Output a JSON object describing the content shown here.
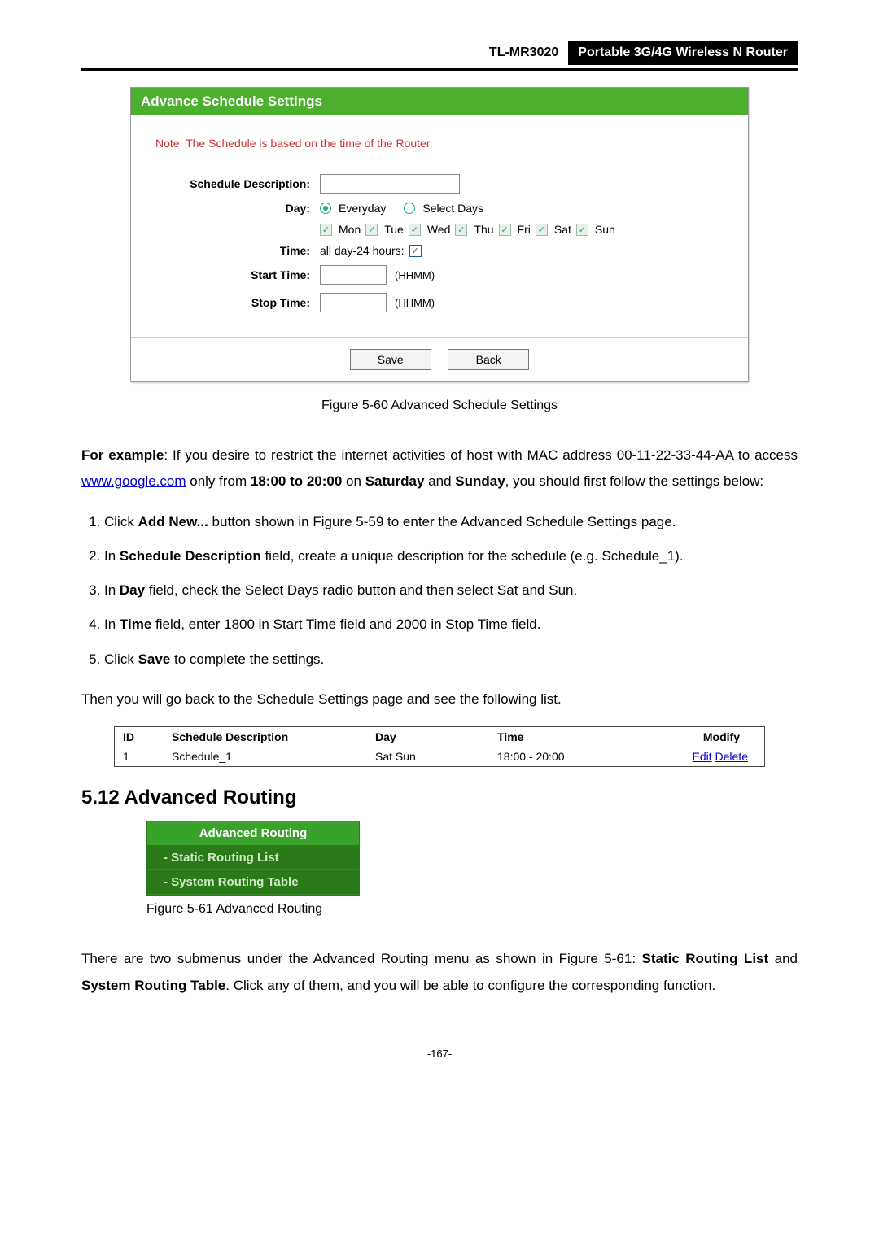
{
  "header": {
    "model": "TL-MR3020",
    "description": "Portable 3G/4G Wireless N Router"
  },
  "panel": {
    "title": "Advance Schedule Settings",
    "note": "Note: The Schedule is based on the time of the Router.",
    "labels": {
      "desc": "Schedule Description:",
      "day": "Day:",
      "time": "Time:",
      "start": "Start Time:",
      "stop": "Stop Time:"
    },
    "day_option_everyday": "Everyday",
    "day_option_select": "Select Days",
    "days": [
      "Mon",
      "Tue",
      "Wed",
      "Thu",
      "Fri",
      "Sat",
      "Sun"
    ],
    "time_allday": "all day-24 hours:",
    "hhmm": "(HHMM)",
    "save": "Save",
    "back": "Back"
  },
  "captions": {
    "fig60": "Figure 5-60    Advanced Schedule Settings",
    "fig61": "Figure 5-61    Advanced Routing"
  },
  "body": {
    "example_lead": "For example",
    "example_text1": ": If you desire to restrict the internet activities of host with MAC address 00-11-22-33-44-AA to access ",
    "example_link": "www.google.com",
    "example_text2": " only from ",
    "example_bold_time": "18:00 to 20:00",
    "example_text3": " on ",
    "example_bold_sat": "Saturday",
    "example_text4": " and ",
    "example_bold_sun": "Sunday",
    "example_text5": ", you should first follow the settings below:",
    "then_text": "Then you will go back to the Schedule Settings page and see the following list."
  },
  "steps": {
    "s1a": "Click ",
    "s1b": "Add New...",
    "s1c": " button shown in Figure 5-59 to enter the Advanced Schedule Settings page.",
    "s2a": "In ",
    "s2b": "Schedule Description",
    "s2c": " field, create a unique description for the schedule (e.g. Schedule_1).",
    "s3a": "In ",
    "s3b": "Day",
    "s3c": " field, check the Select Days radio button and then select Sat and Sun.",
    "s4a": "In ",
    "s4b": "Time",
    "s4c": " field, enter 1800 in Start Time field and 2000 in Stop Time field.",
    "s5a": "Click ",
    "s5b": "Save",
    "s5c": " to complete the settings."
  },
  "table": {
    "headers": {
      "id": "ID",
      "desc": "Schedule Description",
      "day": "Day",
      "time": "Time",
      "modify": "Modify"
    },
    "row": {
      "id": "1",
      "desc": "Schedule_1",
      "day": "Sat Sun",
      "time": "18:00 - 20:00",
      "edit": "Edit",
      "delete": "Delete"
    }
  },
  "section_heading": "5.12 Advanced Routing",
  "menu": {
    "head": "Advanced Routing",
    "item1": "- Static Routing List",
    "item2": "- System Routing Table"
  },
  "closing": {
    "t1": "There are two submenus under the Advanced Routing menu as shown in Figure 5-61: ",
    "b1": "Static Routing List",
    "t2": " and ",
    "b2": "System Routing Table",
    "t3": ". Click any of them, and you will be able to configure the corresponding function."
  },
  "page_number": "-167-"
}
